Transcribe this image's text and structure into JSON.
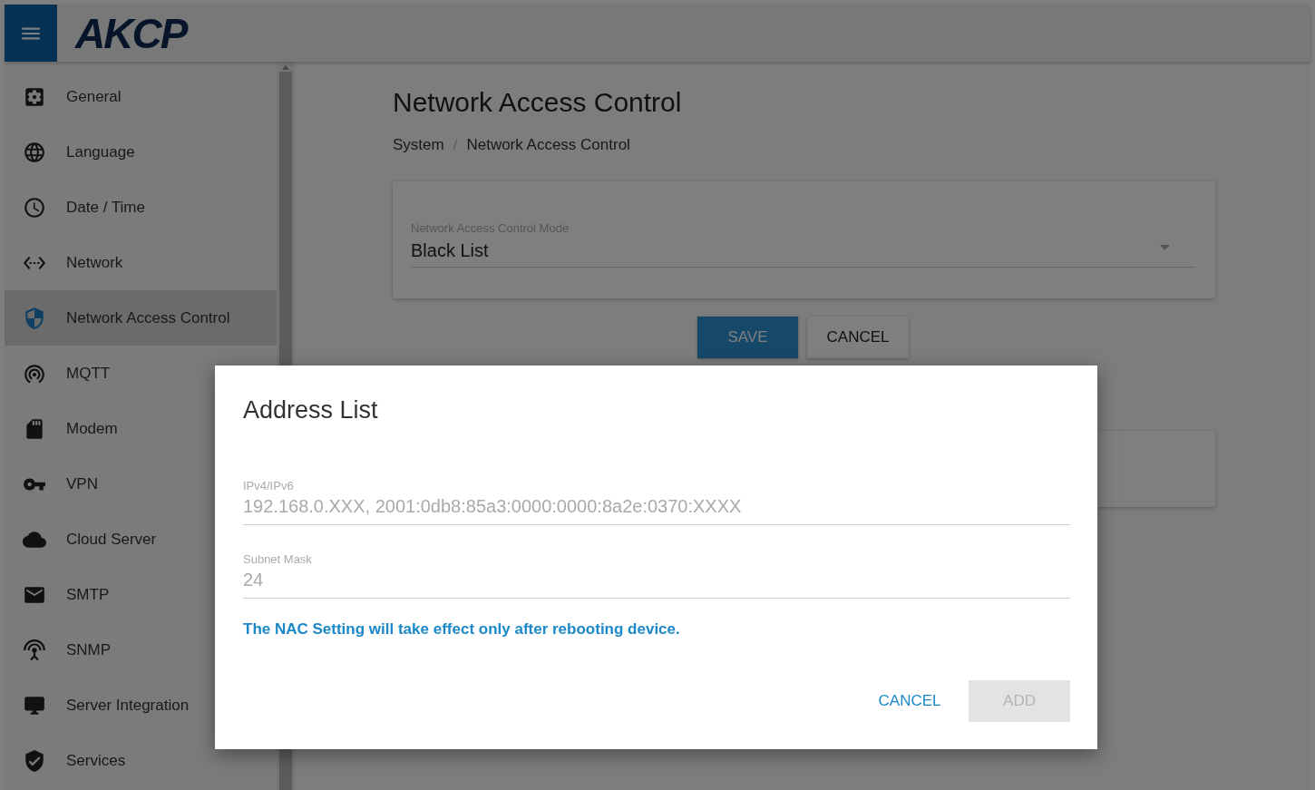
{
  "header": {
    "logo": "AKCP"
  },
  "sidebar": {
    "items": [
      {
        "label": "General",
        "kind": "general",
        "selected": false
      },
      {
        "label": "Language",
        "kind": "language",
        "selected": false
      },
      {
        "label": "Date / Time",
        "kind": "time",
        "selected": false
      },
      {
        "label": "Network",
        "kind": "network",
        "selected": false
      },
      {
        "label": "Network Access Control",
        "kind": "nac",
        "selected": true
      },
      {
        "label": "MQTT",
        "kind": "mqtt",
        "selected": false
      },
      {
        "label": "Modem",
        "kind": "modem",
        "selected": false
      },
      {
        "label": "VPN",
        "kind": "vpn",
        "selected": false
      },
      {
        "label": "Cloud Server",
        "kind": "cloud",
        "selected": false
      },
      {
        "label": "SMTP",
        "kind": "smtp",
        "selected": false
      },
      {
        "label": "SNMP",
        "kind": "snmp",
        "selected": false
      },
      {
        "label": "Server Integration",
        "kind": "server",
        "selected": false
      },
      {
        "label": "Services",
        "kind": "services",
        "selected": false
      }
    ]
  },
  "page": {
    "title": "Network Access Control",
    "breadcrumb": [
      "System",
      "Network Access Control"
    ],
    "breadcrumb_separator": "/",
    "mode_select": {
      "label": "Network Access Control Mode",
      "value": "Black List"
    },
    "buttons": [
      {
        "label": "SAVE",
        "kind": "primary"
      },
      {
        "label": "CANCEL",
        "kind": "secondary"
      }
    ]
  },
  "dialog": {
    "title": "Address List",
    "fields": [
      {
        "label": "IPv4/IPv6",
        "placeholder": "192.168.0.XXX, 2001:0db8:85a3:0000:0000:8a2e:0370:XXXX"
      },
      {
        "label": "Subnet Mask",
        "placeholder": "24"
      }
    ],
    "message": "The NAC Setting will take effect only after rebooting device.",
    "buttons": [
      {
        "label": "CANCEL",
        "kind": "text",
        "disabled": false
      },
      {
        "label": "ADD",
        "kind": "contained",
        "disabled": true
      }
    ]
  }
}
